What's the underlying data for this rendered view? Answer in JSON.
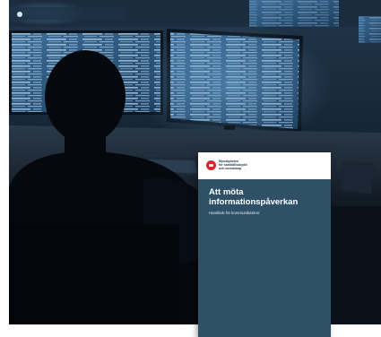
{
  "booklet": {
    "org_name": "Myndigheten\nför samhällsskydd\noch beredskap",
    "title": "Att möta\ninformationspåverkan",
    "subtitle": "Handbok för kommunikatörer"
  },
  "colors": {
    "booklet_cover": "#2f5168",
    "logo_red": "#d6262a",
    "room_dark": "#0d1722",
    "screen_glow": "#6fa6d1"
  }
}
